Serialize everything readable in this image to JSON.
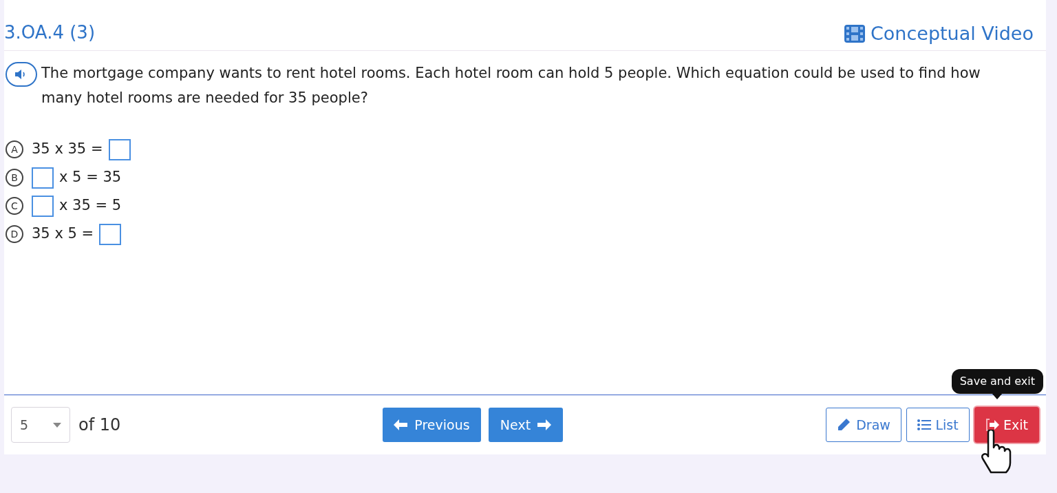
{
  "header": {
    "standard": "3.OA.4 (3)",
    "video_link": "Conceptual Video"
  },
  "question": {
    "text": "The mortgage company wants to rent hotel rooms. Each hotel room can hold 5 people. Which equation could be used to find how many hotel rooms are needed for 35 people?"
  },
  "options": [
    {
      "letter": "A",
      "parts": [
        {
          "kind": "text",
          "text": "35 x 35 ="
        },
        {
          "kind": "box"
        }
      ]
    },
    {
      "letter": "B",
      "parts": [
        {
          "kind": "box"
        },
        {
          "kind": "text",
          "text": "x 5 = 35"
        }
      ]
    },
    {
      "letter": "C",
      "parts": [
        {
          "kind": "box"
        },
        {
          "kind": "text",
          "text": "x 35 = 5"
        }
      ]
    },
    {
      "letter": "D",
      "parts": [
        {
          "kind": "text",
          "text": "35 x 5 ="
        },
        {
          "kind": "box"
        }
      ]
    }
  ],
  "footer": {
    "page_select": "5",
    "page_total": "of 10",
    "previous": "Previous",
    "next": "Next",
    "draw": "Draw",
    "list": "List",
    "exit": "Exit",
    "tooltip": "Save and exit"
  }
}
